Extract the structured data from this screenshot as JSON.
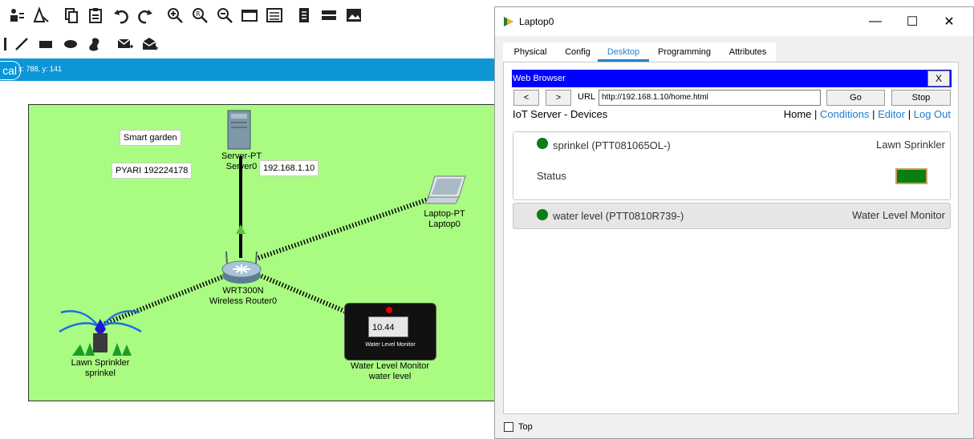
{
  "canvas": {
    "coords_text": "x: 788, y: 141",
    "tab_partial_label": "cal",
    "notes": {
      "title": "Smart garden",
      "owner": "PYARI 192224178"
    },
    "server": {
      "model": "Server-PT",
      "name": "Server0",
      "ip": "192.168.1.10"
    },
    "laptop": {
      "model": "Laptop-PT",
      "name": "Laptop0"
    },
    "router": {
      "model": "WRT300N",
      "name": "Wireless Router0"
    },
    "sprinkler": {
      "model": "Lawn Sprinkler",
      "name": "sprinkel"
    },
    "monitor": {
      "model": "Water Level Monitor",
      "name": "water level",
      "reading": "10.44",
      "screen_label": "Water Level Monitor"
    }
  },
  "window": {
    "title": "Laptop0",
    "controls": {
      "minimize": "—",
      "maximize": "☐",
      "close": "✕"
    },
    "tabs": [
      {
        "label": "Physical",
        "active": false
      },
      {
        "label": "Config",
        "active": false
      },
      {
        "label": "Desktop",
        "active": true
      },
      {
        "label": "Programming",
        "active": false
      },
      {
        "label": "Attributes",
        "active": false
      }
    ],
    "browser": {
      "title": "Web Browser",
      "close": "X",
      "back": "<",
      "forward": ">",
      "url_label": "URL",
      "url": "http://192.168.1.10/home.html",
      "go": "Go",
      "stop": "Stop"
    },
    "page": {
      "title": "IoT Server - Devices",
      "nav": {
        "home": "Home",
        "sep": "|",
        "conditions": "Conditions",
        "editor": "Editor",
        "logout": "Log Out"
      },
      "devices": [
        {
          "name": "sprinkel (PTT081065OL-)",
          "type": "Lawn Sprinkler",
          "expanded": true,
          "status_label": "Status",
          "status_color": "#0b7d17"
        },
        {
          "name": "water level (PTT0810R739-)",
          "type": "Water Level Monitor",
          "expanded": false,
          "status_color": "#0b7d17"
        }
      ]
    },
    "top_label": "Top"
  },
  "colors": {
    "accent": "#0d96d6",
    "garden": "#aafb82",
    "browser_bar": "#0000ff",
    "link": "#1f7bd6",
    "online": "#0b7d17"
  }
}
